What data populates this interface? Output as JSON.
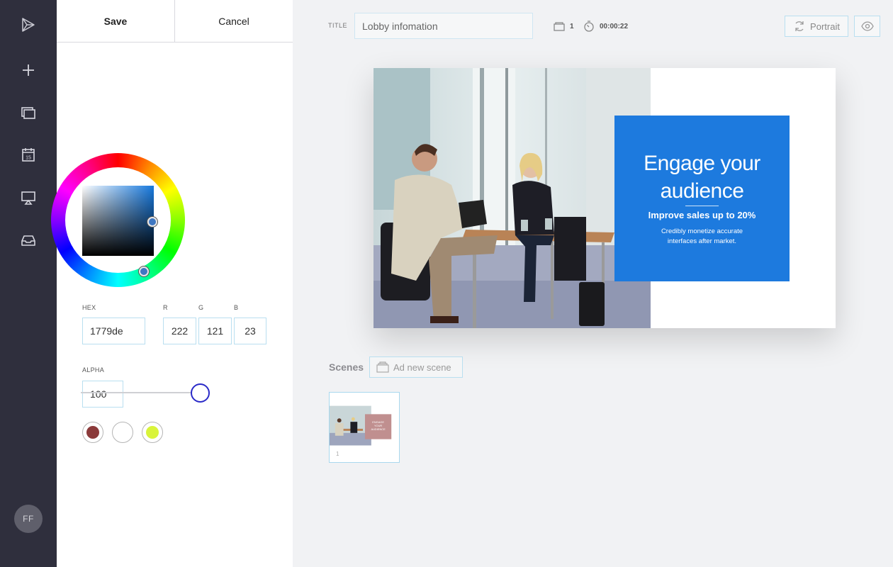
{
  "nav": {
    "items": [
      {
        "name": "logo",
        "icon": "play-logo-icon"
      },
      {
        "name": "add",
        "icon": "plus-icon"
      },
      {
        "name": "scenes",
        "icon": "layers-icon"
      },
      {
        "name": "schedule",
        "icon": "calendar-icon"
      },
      {
        "name": "present",
        "icon": "presentation-icon"
      },
      {
        "name": "inbox",
        "icon": "inbox-icon"
      }
    ],
    "avatar_initials": "FF"
  },
  "panel": {
    "save_label": "Save",
    "cancel_label": "Cancel",
    "hex_label": "HEX",
    "hex_value": "1779de",
    "r_label": "R",
    "g_label": "G",
    "b_label": "B",
    "r_value": "222",
    "g_value": "121",
    "b_value": "23",
    "alpha_label": "ALPHA",
    "alpha_value": "100",
    "alpha_fraction": 1.0,
    "swatches": [
      "#8b3a3a",
      "#ffffff",
      "#d9f43a"
    ]
  },
  "toolbar": {
    "title_label": "TITLE",
    "title_value": "Lobby infomation",
    "scene_count": "1",
    "duration": "00:00:22",
    "orientation_label": "Portrait",
    "preview_icon": "eye-icon"
  },
  "slide": {
    "headline": "Engage your audience",
    "subheadline": "Improve sales up to 20%",
    "body": "Credibly monetize accurate interfaces after market.",
    "card_color": "#1d7ade"
  },
  "scenes": {
    "label": "Scenes",
    "add_label": "Ad new scene",
    "items": [
      {
        "number": "1",
        "thumb_text": "ENGAGE YOUR AUDIENCE",
        "thumb_color": "#c08f8f"
      }
    ]
  }
}
